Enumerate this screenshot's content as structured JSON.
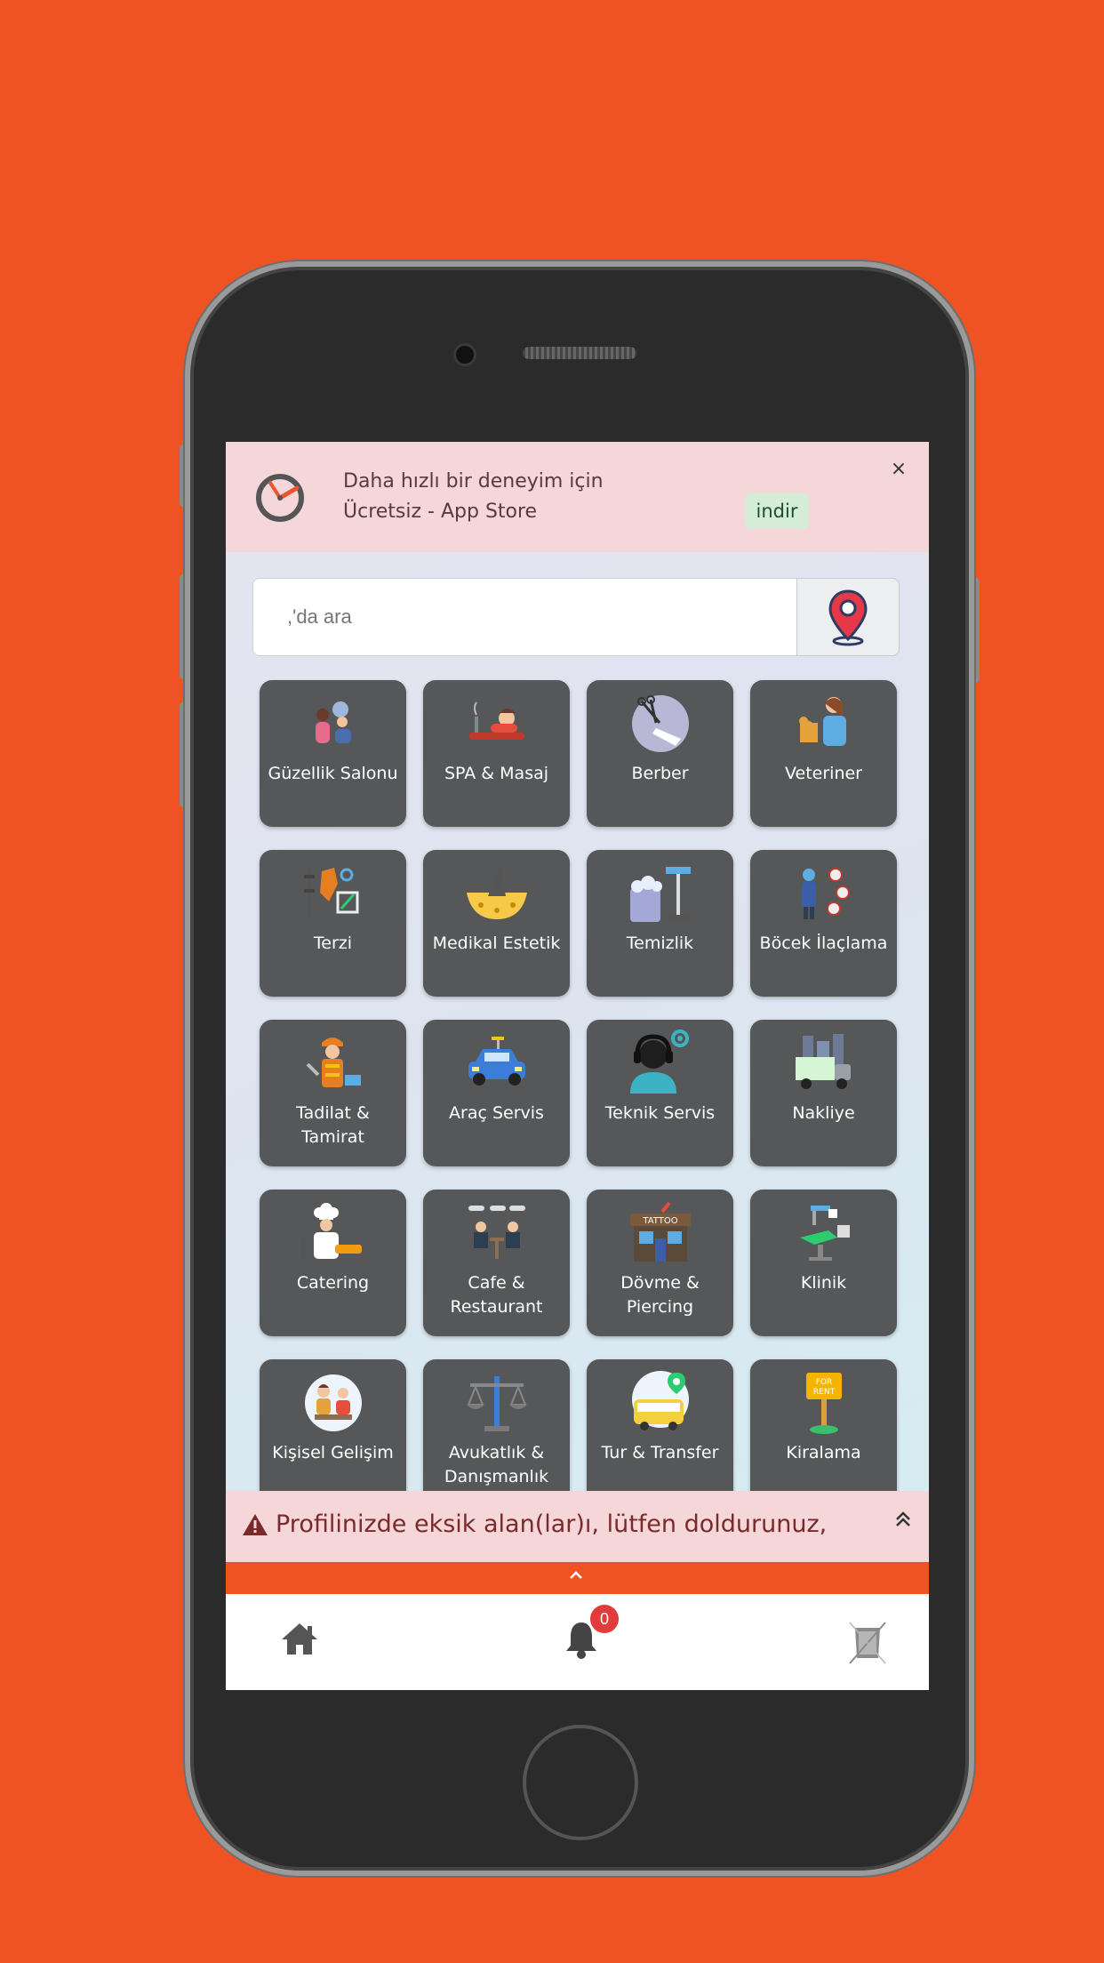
{
  "banner": {
    "line1": "Daha hızlı bir deneyim için",
    "line2": "Ücretsiz - App Store",
    "download_label": "indir",
    "close_label": "×"
  },
  "search": {
    "placeholder": ",'da ara"
  },
  "categories": [
    {
      "label": "Güzellik Salonu",
      "icon": "beauty-salon-icon"
    },
    {
      "label": "SPA & Masaj",
      "icon": "spa-massage-icon"
    },
    {
      "label": "Berber",
      "icon": "barber-scissors-icon"
    },
    {
      "label": "Veteriner",
      "icon": "veterinarian-icon"
    },
    {
      "label": "Terzi",
      "icon": "tailor-icon"
    },
    {
      "label": "Medikal Estetik",
      "icon": "medical-aesthetic-icon"
    },
    {
      "label": "Temizlik",
      "icon": "cleaning-icon"
    },
    {
      "label": "Böcek İlaçlama",
      "icon": "pest-control-icon"
    },
    {
      "label": "Tadilat & Tamirat",
      "icon": "renovation-repair-icon"
    },
    {
      "label": "Araç Servis",
      "icon": "car-service-icon"
    },
    {
      "label": "Teknik Servis",
      "icon": "technical-service-icon"
    },
    {
      "label": "Nakliye",
      "icon": "moving-truck-icon"
    },
    {
      "label": "Catering",
      "icon": "catering-chef-icon"
    },
    {
      "label": "Cafe & Restaurant",
      "icon": "cafe-restaurant-icon"
    },
    {
      "label": "Dövme & Piercing",
      "icon": "tattoo-piercing-icon"
    },
    {
      "label": "Klinik",
      "icon": "clinic-icon"
    },
    {
      "label": "Kişisel Gelişim",
      "icon": "personal-development-icon"
    },
    {
      "label": "Avukatlık & Danışmanlık",
      "icon": "law-scales-icon"
    },
    {
      "label": "Tur & Transfer",
      "icon": "tour-bus-icon"
    },
    {
      "label": "Kiralama",
      "icon": "for-rent-sign-icon"
    }
  ],
  "warning": {
    "text": "Profilinizde eksik alan(lar)ı, lütfen doldurunuz,"
  },
  "nav": {
    "notification_count": "0"
  },
  "colors": {
    "background": "#ef5323",
    "tile": "#555758",
    "banner": "#f5d6d9"
  }
}
